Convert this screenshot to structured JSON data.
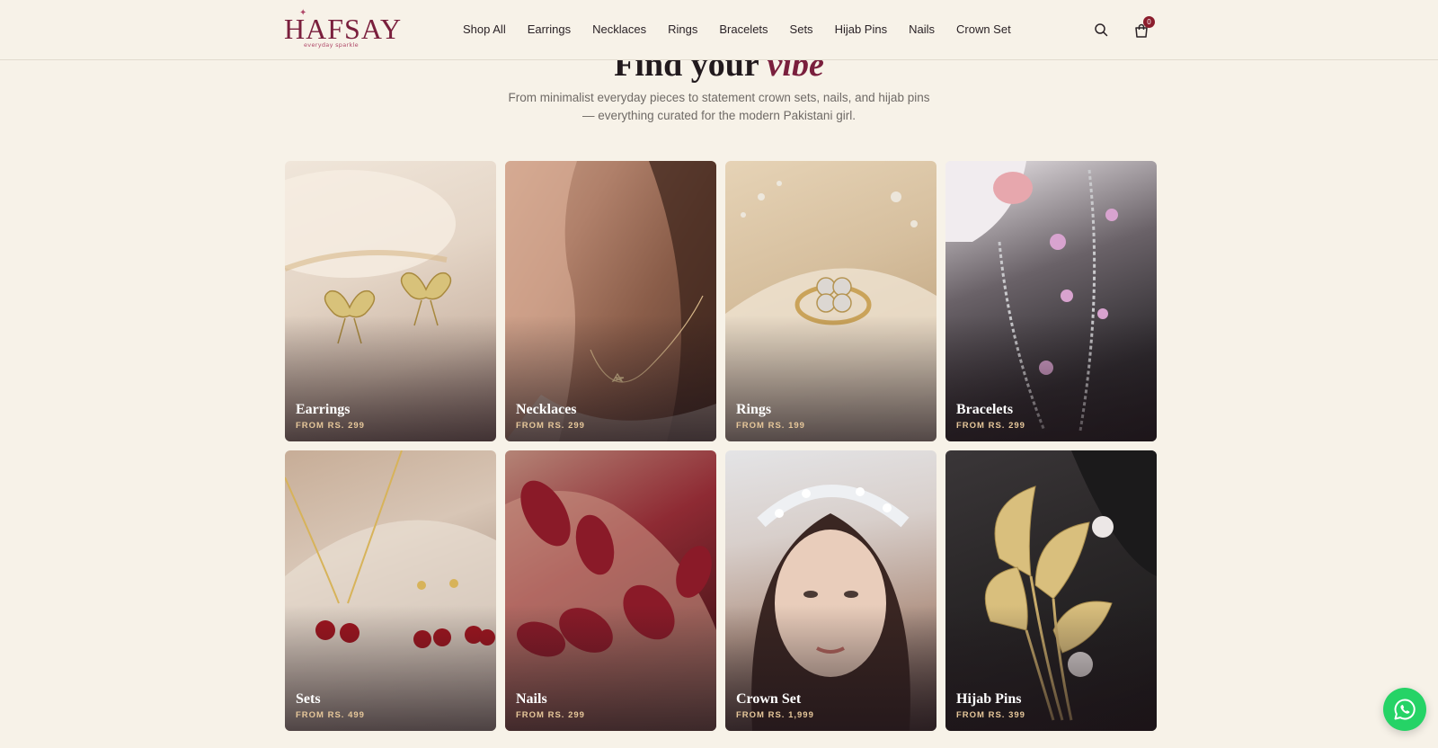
{
  "brand": {
    "name": "HAFSAY",
    "tagline": "everyday sparkle",
    "color": "#7a1f3d"
  },
  "nav": {
    "items": [
      {
        "label": "Shop All"
      },
      {
        "label": "Earrings"
      },
      {
        "label": "Necklaces"
      },
      {
        "label": "Rings"
      },
      {
        "label": "Bracelets"
      },
      {
        "label": "Sets"
      },
      {
        "label": "Hijab Pins"
      },
      {
        "label": "Nails"
      },
      {
        "label": "Crown Set"
      }
    ]
  },
  "header": {
    "search_icon": "search-icon",
    "cart_icon": "shopping-bag-icon",
    "cart_count": "0"
  },
  "hero": {
    "title_main": "Find your ",
    "title_accent": "vibe",
    "subtitle": "From minimalist everyday pieces to statement crown sets, nails, and hijab pins — everything curated for the modern Pakistani girl."
  },
  "categories": [
    {
      "title": "Earrings",
      "price": "FROM RS. 299"
    },
    {
      "title": "Necklaces",
      "price": "FROM RS. 299"
    },
    {
      "title": "Rings",
      "price": "FROM RS. 199"
    },
    {
      "title": "Bracelets",
      "price": "FROM RS. 299"
    },
    {
      "title": "Sets",
      "price": "FROM RS. 499"
    },
    {
      "title": "Nails",
      "price": "FROM RS. 299"
    },
    {
      "title": "Crown Set",
      "price": "FROM RS. 1,999"
    },
    {
      "title": "Hijab Pins",
      "price": "FROM RS. 399"
    }
  ],
  "whatsapp": {
    "icon": "whatsapp-icon",
    "color": "#25d366"
  }
}
